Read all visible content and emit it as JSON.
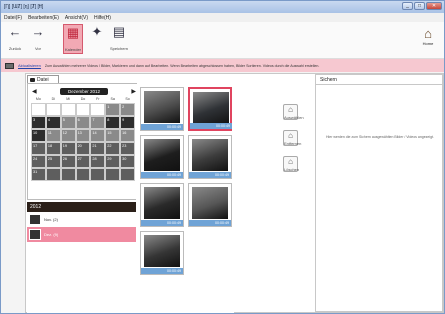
{
  "window": {
    "title": "[Ƞ] [ƜȾ] [ƞ] [Ⱦ] [ƗƗ]"
  },
  "menu": [
    "Datei(F)",
    "Bearbeiten(E)",
    "Ansicht(V)",
    "Hilfe(H)"
  ],
  "toolbar": {
    "items": [
      {
        "name": "back",
        "label": "Zurück",
        "icon": "←"
      },
      {
        "name": "forward",
        "label": "Vor",
        "icon": "→"
      },
      {
        "name": "calendar",
        "label": "Kalender",
        "icon": "▦"
      },
      {
        "name": "star",
        "label": "",
        "icon": "✦"
      },
      {
        "name": "save",
        "label": "Speichern",
        "icon": "▤"
      }
    ],
    "home_label": "Home"
  },
  "infobar": {
    "link": "Aktualisieren",
    "text": "Zum Auswählen mehrerer Videos / Bilder, Markieren und dann auf Bearbeiten. Wenn Bearbeiten abgeschlossen haben, Bilder Sortieren. Videos durch die Auswahl erstellen."
  },
  "tab": {
    "label": "Datei"
  },
  "calendar": {
    "month": "Dezember 2012",
    "dow": [
      "Mo",
      "Di",
      "Mi",
      "Do",
      "Fr",
      "Sa",
      "So"
    ],
    "days": [
      [
        "",
        "",
        "",
        "",
        "",
        "1",
        "2"
      ],
      [
        "3",
        "4",
        "5",
        "6",
        "7",
        "8",
        "9"
      ],
      [
        "10",
        "11",
        "12",
        "13",
        "14",
        "15",
        "16"
      ],
      [
        "17",
        "18",
        "19",
        "20",
        "21",
        "22",
        "23"
      ],
      [
        "24",
        "25",
        "26",
        "27",
        "28",
        "29",
        "30"
      ],
      [
        "31",
        "",
        "",
        "",
        "",
        "",
        ""
      ]
    ]
  },
  "years": {
    "title": "2012",
    "rows": [
      {
        "label": "Nov. (2)",
        "selected": false
      },
      {
        "label": "Dez. (9)",
        "selected": true
      }
    ]
  },
  "thumbnails": [
    {
      "caption": "00:00:49",
      "selected": false
    },
    {
      "caption": "00:00:49",
      "selected": true
    },
    {
      "caption": "00:00:49",
      "selected": false
    },
    {
      "caption": "00:00:49",
      "selected": false
    },
    {
      "caption": "00:00:49",
      "selected": false
    },
    {
      "caption": "00:00:49",
      "selected": false
    },
    {
      "caption": "00:00:49",
      "selected": false
    }
  ],
  "side_buttons": [
    {
      "label": "Auswählen",
      "icon": "⌂"
    },
    {
      "label": "Entfernen",
      "icon": "⌂"
    },
    {
      "label": "Löschen",
      "icon": "⌂"
    }
  ],
  "right_pane": {
    "tab": "Sichern",
    "hint": "Hier werden die zum Sichern ausgewählten Bilder / Videos angezeigt."
  }
}
